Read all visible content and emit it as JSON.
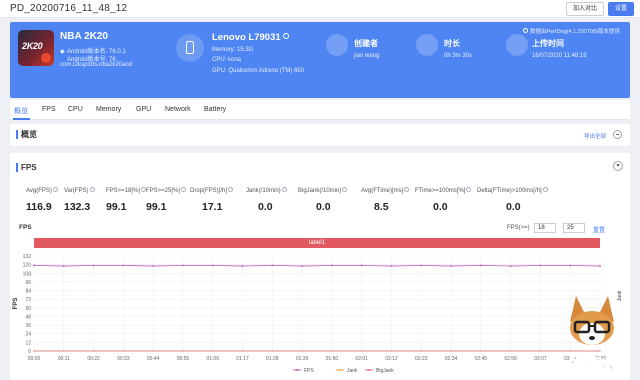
{
  "window": {
    "title": "PD_20200716_11_48_12"
  },
  "toolbar": {
    "import_label": "加入对比",
    "settings_label": "设置"
  },
  "app": {
    "icon_text": "2K20",
    "name": "NBA 2K20",
    "android_version": "Android版本名: 76.0.1",
    "android_code": "Android版本号: 76",
    "package": "com.t2ksports.nba2k20and"
  },
  "device": {
    "name": "Lenovo L79031",
    "memory": "Memory: 15.3G",
    "cpu": "CPU: kona",
    "gpu": "GPU: Qualcomm Adreno (TM) 650"
  },
  "creator": {
    "label": "创建者",
    "value": "jian wang"
  },
  "duration": {
    "label": "时长",
    "value": "0h 3m 30s"
  },
  "upload": {
    "label": "上传时间",
    "value": "16/07/2020 11:48:18"
  },
  "perfdog_version": "数据由PerfDog(4.1.200708)版本提供",
  "tabs": [
    {
      "label": "概览",
      "active": true
    },
    {
      "label": "FPS"
    },
    {
      "label": "CPU"
    },
    {
      "label": "Memory"
    },
    {
      "label": "GPU"
    },
    {
      "label": "Network"
    },
    {
      "label": "Battery"
    }
  ],
  "overview": {
    "title": "概览",
    "export_label": "导出全部"
  },
  "fps_section": {
    "title": "FPS",
    "stats": [
      {
        "label": "Avg(FPS)",
        "value": "116.9"
      },
      {
        "label": "Var(FPS)",
        "value": "132.3"
      },
      {
        "label": "FPS>=18[%]",
        "value": "99.1"
      },
      {
        "label": "FPS>=25[%]",
        "value": "99.1"
      },
      {
        "label": "Drop(FPS)[/h]",
        "value": "17.1"
      },
      {
        "label": "Jank(/10min)",
        "value": "0.0"
      },
      {
        "label": "BigJank(/10min)",
        "value": "0.0"
      },
      {
        "label": "Avg(FTime)[ms]",
        "value": "8.5"
      },
      {
        "label": "FTime>=100ms[%]",
        "value": "0.0"
      },
      {
        "label": "Delta(FTime)>100ms[/h]",
        "value": "0.0"
      }
    ],
    "chart_subtitle": "FPS",
    "threshold_label": "FPS(>=)",
    "threshold_values": [
      "18",
      "25"
    ],
    "reset_label": "重置",
    "label_bar": "label1"
  },
  "chart_data": {
    "type": "line",
    "ylabel": "FPS",
    "ylim": [
      0,
      132
    ],
    "yticks": [
      0,
      12,
      24,
      36,
      48,
      60,
      72,
      84,
      96,
      108,
      120,
      132
    ],
    "x": [
      "00:00",
      "00:11",
      "00:22",
      "00:33",
      "00:44",
      "00:55",
      "01:06",
      "01:17",
      "01:28",
      "01:39",
      "01:50",
      "02:01",
      "02:12",
      "02:23",
      "02:34",
      "02:45",
      "02:56",
      "03:07",
      "03:18",
      "03:29"
    ],
    "series": [
      {
        "name": "FPS",
        "color": "#c05ab8",
        "values": [
          119,
          118,
          119,
          119,
          118,
          119,
          119,
          118,
          119,
          118,
          119,
          119,
          118,
          119,
          118,
          119,
          118,
          119,
          119,
          118
        ]
      },
      {
        "name": "Jank",
        "color": "#f0a050",
        "values": [
          0,
          0,
          0,
          0,
          0,
          0,
          0,
          0,
          0,
          0,
          0,
          0,
          0,
          0,
          0,
          0,
          0,
          0,
          0,
          0
        ]
      },
      {
        "name": "BigJank",
        "color": "#e0657a",
        "values": [
          0,
          0,
          0,
          0,
          0,
          0,
          0,
          0,
          0,
          0,
          0,
          0,
          0,
          0,
          0,
          0,
          0,
          0,
          0,
          0
        ]
      }
    ],
    "right_axis_label": "Jank",
    "grid": true,
    "legend": "bottom"
  },
  "watermark": {
    "text": "科技犬"
  }
}
